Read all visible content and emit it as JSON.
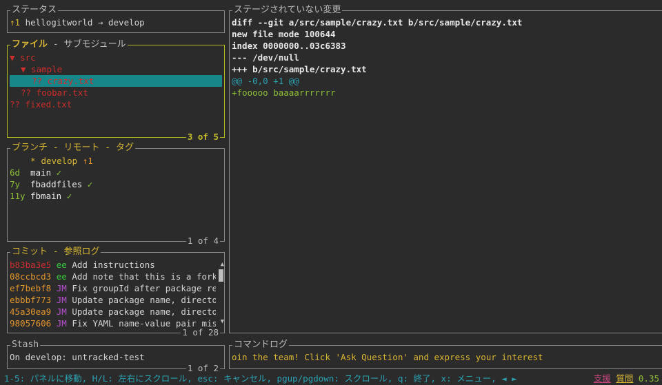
{
  "status_panel": {
    "title": "ステータス",
    "ahead": "↑1",
    "repo_branch": "hellogitworld → develop"
  },
  "files_panel": {
    "title_active": "ファイル",
    "title_sep": " - ",
    "title_other": "サブモジュール",
    "items": [
      {
        "text": "▼ src",
        "depth": 0,
        "color": "red",
        "selected": false
      },
      {
        "text": "▼ sample",
        "depth": 1,
        "color": "red",
        "selected": false
      },
      {
        "text": "?? crazy.txt",
        "depth": 2,
        "color": "red",
        "selected": true
      },
      {
        "text": "?? foobar.txt",
        "depth": 1,
        "color": "red",
        "selected": false
      },
      {
        "text": "?? fixed.txt",
        "depth": 0,
        "color": "red",
        "selected": false
      }
    ],
    "footer": "3 of 5"
  },
  "branches_panel": {
    "title": "ブランチ - リモート - タグ",
    "items": [
      {
        "age": "",
        "marker": "*",
        "name": "develop",
        "status": "↑1",
        "status_color": "orange"
      },
      {
        "age": "6d",
        "marker": "",
        "name": "main",
        "status": "✓",
        "status_color": "green"
      },
      {
        "age": "7y",
        "marker": "",
        "name": "fbaddfiles",
        "status": "✓",
        "status_color": "green"
      },
      {
        "age": "11y",
        "marker": "",
        "name": "fbmain",
        "status": "✓",
        "status_color": "green"
      }
    ],
    "footer": "1 of 4"
  },
  "commits_panel": {
    "title": "コミット - 参照ログ",
    "items": [
      {
        "sha": "b83ba3e5",
        "sha_color": "red",
        "author": "ee",
        "author_color": "greenbright",
        "msg": "Add instructions"
      },
      {
        "sha": "08ccbcd3",
        "sha_color": "orange",
        "author": "ee",
        "author_color": "greenbright",
        "msg": "Add note that this is a fork"
      },
      {
        "sha": "ef7bebf8",
        "sha_color": "orange",
        "author": "JM",
        "author_color": "purple",
        "msg": "Fix groupId after package re"
      },
      {
        "sha": "ebbbf773",
        "sha_color": "orange",
        "author": "JM",
        "author_color": "purple",
        "msg": "Update package name, directo"
      },
      {
        "sha": "45a30ea9",
        "sha_color": "orange",
        "author": "JM",
        "author_color": "purple",
        "msg": "Update package name, directo"
      },
      {
        "sha": "98057606",
        "sha_color": "orange",
        "author": "JM",
        "author_color": "purple",
        "msg": "Fix YAML name-value pair mis"
      }
    ],
    "footer": "1 of 28"
  },
  "stash_panel": {
    "title": "Stash",
    "item": "On develop: untracked-test",
    "footer": "1 of 2"
  },
  "diff_panel": {
    "title": "ステージされていない変更",
    "lines": [
      {
        "text": "diff --git a/src/sample/crazy.txt b/src/sample/crazy.txt",
        "style": "header"
      },
      {
        "text": "new file mode 100644",
        "style": "header"
      },
      {
        "text": "index 0000000..03c6383",
        "style": "header"
      },
      {
        "text": "--- /dev/null",
        "style": "header"
      },
      {
        "text": "+++ b/src/sample/crazy.txt",
        "style": "header"
      },
      {
        "text": "@@ -0,0 +1 @@",
        "style": "hunk"
      },
      {
        "text": "+fooooo baaaarrrrrrr",
        "style": "add"
      }
    ]
  },
  "command_log_panel": {
    "title": "コマンドログ",
    "text": "oin the team! Click 'Ask Question' and express your interest"
  },
  "status_bar": {
    "keys": "1-5: パネルに移動, H/L: 左右にスクロール, esc: キャンセル, pgup/pgdown: スクロール, q: 終了, x: メニュー, ◄ ►",
    "donate": "支援",
    "ask": "質問",
    "version": "0.35"
  },
  "colors": {
    "active_border": "#b5bd20",
    "inactive_border": "#8a8a8a",
    "selection": "#17878a",
    "background": "#2b2b2b"
  }
}
